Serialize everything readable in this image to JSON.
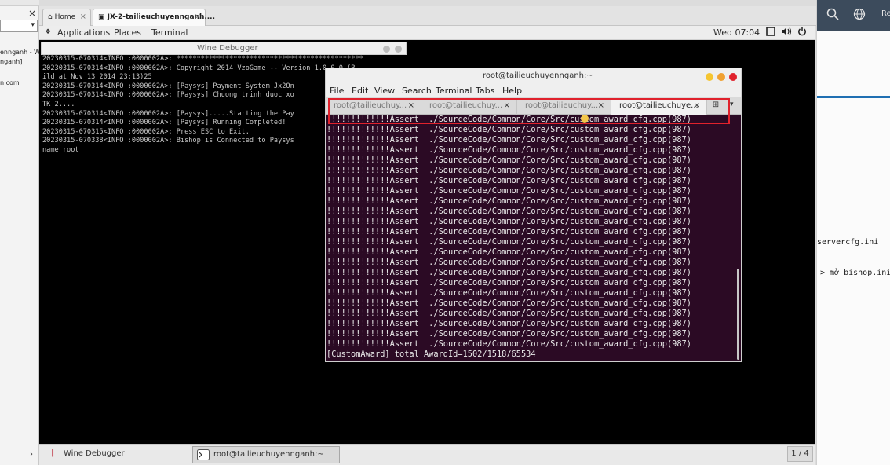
{
  "left_strip": {
    "close_glyph": "×",
    "dropdown_arrow": "▾",
    "texts": [
      "ennganh - W",
      "nganh]",
      "n.com"
    ],
    "bottom_arrow": "›"
  },
  "right_panel": {
    "search_icon": "search-icon",
    "globe_icon": "globe-icon",
    "top_text": "Re",
    "line1": "servercfg.ini",
    "line2": "> mở bishop.ini"
  },
  "vm_tabs": [
    {
      "label": "Home",
      "icon": "home-icon",
      "close": "×"
    },
    {
      "label": "JX-2-tailieuchuyennganh....",
      "icon": "vm-icon",
      "close": "×"
    }
  ],
  "gnome": {
    "applications": "Applications",
    "places": "Places",
    "terminal": "Terminal",
    "clock": "Wed 07:04",
    "window_icon": "window-icon",
    "volume_icon": "volume-icon",
    "power_icon": "power-icon"
  },
  "wine": {
    "title": "Wine Debugger",
    "lines": [
      "20230315-070314<INFO :0000002A>: **********************************************",
      "20230315-070314<INFO :0000002A>: Copyright 2014 VzoGame -- Version 1.0.0.0 (B",
      "ild at Nov 13 2014 23:13)25",
      "20230315-070314<INFO :0000002A>: [Paysys] Payment System Jx2On",
      "20230315-070314<INFO :0000002A>: [Paysys] Chuong trinh duoc xo",
      "TK 2....",
      "20230315-070314<INFO :0000002A>: [Paysys].....Starting the Pay",
      "20230315-070314<INFO :0000002A>: [Paysys] Running Completed!",
      "20230315-070315<INFO :0000002A>: Press ESC to Exit.",
      "20230315-070338<INFO :0000002A>: Bishop is Connected to Paysys",
      "name root"
    ]
  },
  "terminal": {
    "title": "root@tailieuchuyennganh:~",
    "menu": [
      "File",
      "Edit",
      "View",
      "Search",
      "Terminal",
      "Tabs",
      "Help"
    ],
    "tabs": [
      {
        "label": "root@tailieuchuy...",
        "close": "×"
      },
      {
        "label": "root@tailieuchuy...",
        "close": "×"
      },
      {
        "label": "root@tailieuchuy...",
        "close": "×"
      },
      {
        "label": "root@tailieuchuye...",
        "close": "×"
      }
    ],
    "new_tab_glyph": "⊞",
    "tabs_menu_glyph": "▾",
    "assert_line": "!!!!!!!!!!!!!Assert  ./SourceCode/Common/Core/Src/custom_award_cfg.cpp(987)",
    "assert_count": 23,
    "last_line": "[CustomAward] total AwardId=1502/1518/65534"
  },
  "taskbar": {
    "tasks": [
      {
        "label": "Wine Debugger",
        "icon": "wine-icon"
      },
      {
        "label": "root@tailieuchuyennganh:~",
        "icon": "terminal-icon"
      }
    ],
    "workspace": "1 / 4"
  },
  "colors": {
    "terminal_bg": "#2b0a24",
    "highlight": "#e0222c",
    "close_btn": "#e0222c",
    "min_btn": "#f5c531",
    "max_btn": "#f0a132"
  }
}
